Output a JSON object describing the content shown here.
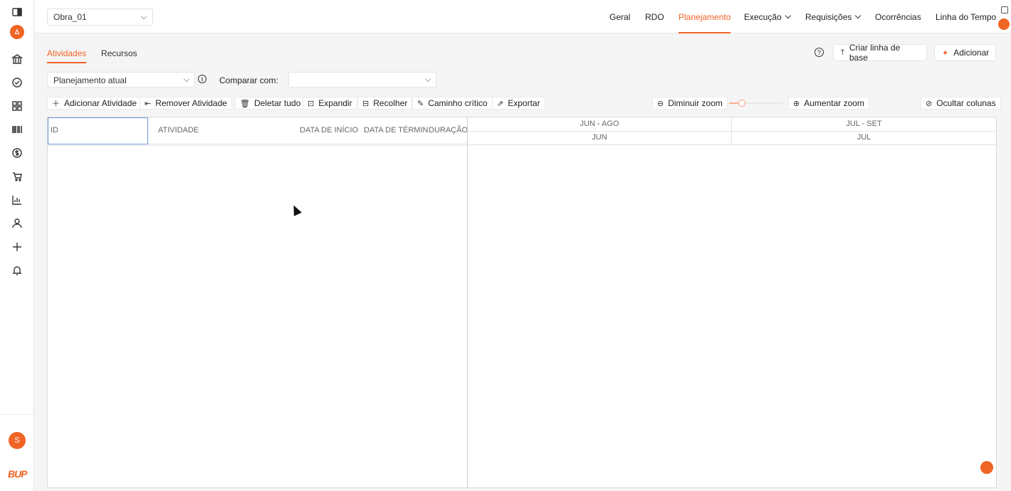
{
  "topbar": {
    "project": "Obra_01",
    "nav": [
      {
        "label": "Geral"
      },
      {
        "label": "RDO"
      },
      {
        "label": "Planejamento"
      },
      {
        "label": "Execução"
      },
      {
        "label": "Requisições"
      },
      {
        "label": "Ocorrências"
      },
      {
        "label": "Linha do Tempo"
      }
    ]
  },
  "sidebar": {
    "icons": [
      "panel-toggle-icon",
      "bank-icon",
      "check-circle-icon",
      "grid-icon",
      "barcode-icon",
      "dollar-icon",
      "cart-icon",
      "chart-icon",
      "user-icon",
      "plus-icon",
      "bell-icon"
    ],
    "avatar": "S",
    "brand": "BUP"
  },
  "subtabs": {
    "activities": "Atividades",
    "resources": "Recursos"
  },
  "actions": {
    "baseline": "Criar linha de base",
    "add": "Adicionar"
  },
  "plan": {
    "current": "Planejamento atual",
    "compare_label": "Comparar com:",
    "compare_value": ""
  },
  "toolbar": {
    "add_activity": "Adicionar Atividade",
    "remove_activity": "Remover Atividade",
    "delete_all": "Deletar tudo",
    "expand": "Expandir",
    "collapse": "Recolher",
    "critical_path": "Caminho crítico",
    "export": "Exportar",
    "zoom_out": "Diminuir zoom",
    "zoom_in": "Aumentar zoom",
    "zoom_level": 0.2,
    "hide_columns": "Ocultar colunas"
  },
  "grid": {
    "columns": [
      "ID",
      "ATIVIDADE",
      "DATA DE INÍCIO",
      "DATA DE TÉRMIN",
      "DURAÇÃO"
    ],
    "timeline_top": [
      "JUN - AGO",
      "JUL - SET"
    ],
    "timeline_bottom": [
      "JUN",
      "JUL"
    ],
    "rows": []
  },
  "colors": {
    "accent": "#f06424",
    "selection": "#6f9ad8"
  }
}
